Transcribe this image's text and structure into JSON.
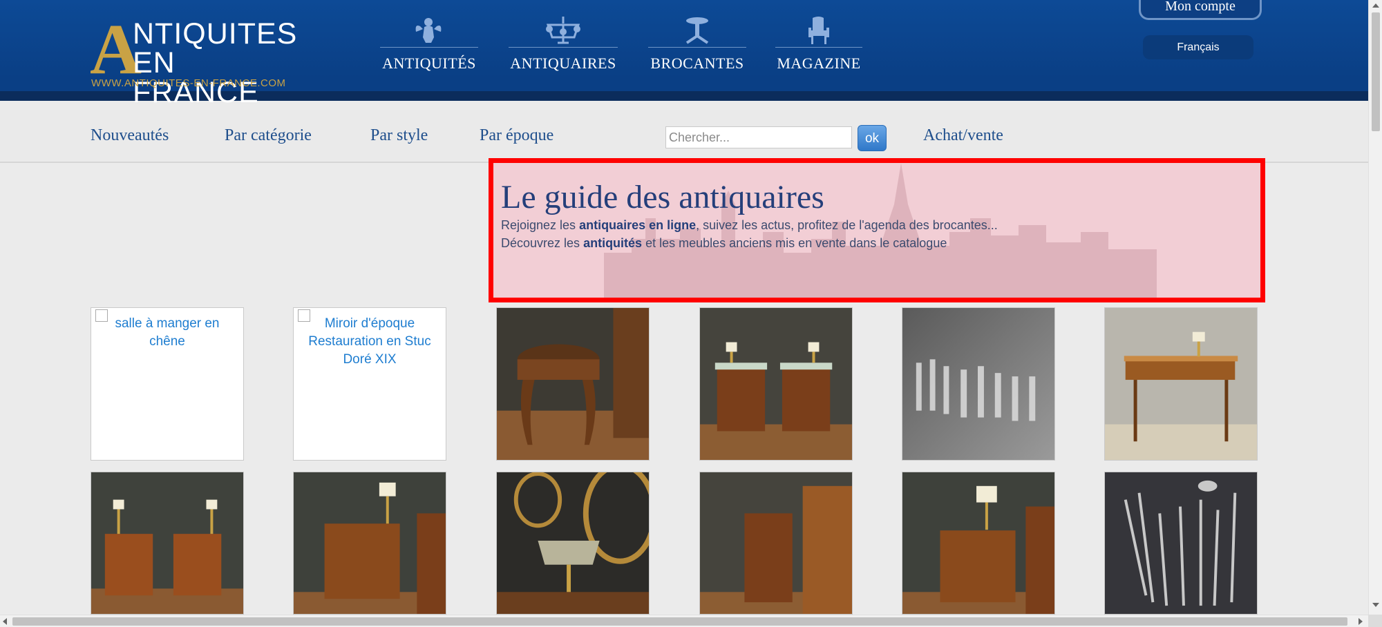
{
  "site": {
    "logo_line1": "NTIQUITES",
    "logo_line2": "EN FRANCE",
    "logo_letter_a": "A",
    "logo_url": "WWW.ANTIQUITES-EN-FRANCE.COM"
  },
  "main_nav": [
    {
      "label": "ANTIQUITÉS",
      "icon": "cherub-icon"
    },
    {
      "label": "ANTIQUAIRES",
      "icon": "chandelier-icon"
    },
    {
      "label": "BROCANTES",
      "icon": "pedestal-table-icon"
    },
    {
      "label": "MAGAZINE",
      "icon": "armchair-icon"
    }
  ],
  "account": {
    "label": "Mon compte"
  },
  "language": {
    "label": "Français"
  },
  "sub_nav": [
    {
      "label": "Nouveautés"
    },
    {
      "label": "Par catégorie"
    },
    {
      "label": "Par style"
    },
    {
      "label": "Par époque"
    },
    {
      "label": "Achat/vente"
    }
  ],
  "search": {
    "placeholder": "Chercher...",
    "button": "ok"
  },
  "hero": {
    "title": "Le guide des antiquaires",
    "line1_pre": "Rejoignez les ",
    "line1_bold": "antiquaires en ligne",
    "line1_post": ", suivez les actus, profitez de l'agenda des brocantes...",
    "line2_pre": "Découvrez les ",
    "line2_bold": "antiquités",
    "line2_post": " et les meubles anciens mis en vente dans le catalogue"
  },
  "products": [
    {
      "alt": "salle à manger en chêne",
      "image": "broken"
    },
    {
      "alt": "Miroir d'époque Restauration en Stuc Doré XIX",
      "image": "broken"
    },
    {
      "image": "stool"
    },
    {
      "image": "pair-nightstands-marble"
    },
    {
      "image": "crystal-glasses"
    },
    {
      "image": "desk-marquetry"
    },
    {
      "image": "pair-nightstands"
    },
    {
      "image": "lamp-cabinet"
    },
    {
      "image": "bouillotte-lamp"
    },
    {
      "image": "small-nightstand"
    },
    {
      "image": "chest-with-lamp"
    },
    {
      "image": "silverware"
    }
  ],
  "colors": {
    "header_blue": "#0d4a96",
    "gold": "#c9a245",
    "link_blue": "#1e4e8c",
    "highlight_red": "#ff0000"
  }
}
